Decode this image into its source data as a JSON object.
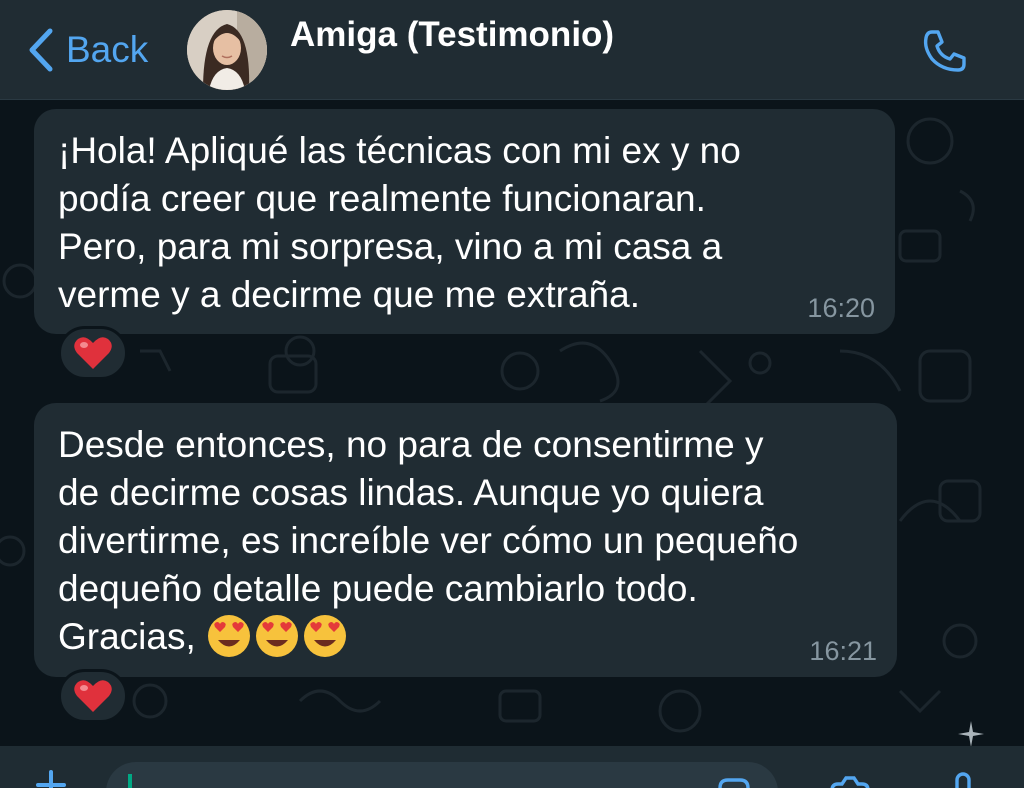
{
  "header": {
    "back_label": "Back",
    "contact_name": "Amiga (Testimonio)",
    "avatar_icon": "profile-photo",
    "call_icon": "phone-icon"
  },
  "messages": [
    {
      "text": "¡Hola! Apliqué las técnicas con mi ex y no\npodía creer que realmente funcionaran.\nPero, para mi sorpresa, vino a mi casa a\nverme y a decirme que me extraña.",
      "time": "16:20",
      "reaction": "❤️"
    },
    {
      "text": "Desde entonces, no para de consentirme y\nde decirme cosas lindas. Aunque yo quiera\ndivertirme, es increíble ver cómo un pequeño\ndequeño detalle puede cambiarlo todo.\nGracias,",
      "emojis": [
        "😍",
        "😍",
        "😍"
      ],
      "time": "16:21",
      "reaction": "❤️"
    }
  ],
  "footer": {
    "icons": [
      "plus-icon",
      "sticker-icon",
      "camera-icon",
      "microphone-icon"
    ]
  },
  "colors": {
    "header_bg": "#202c33",
    "chat_bg": "#0b141a",
    "bubble_bg": "#202c33",
    "accent_blue": "#53a6f0",
    "timestamp": "#8696a0",
    "heart": "#e0313c"
  }
}
